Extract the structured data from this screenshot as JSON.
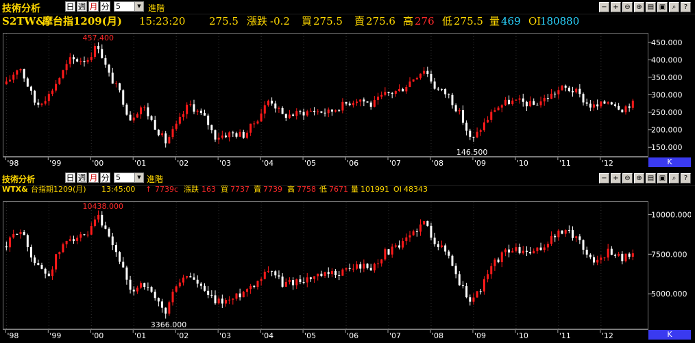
{
  "app": {
    "title": "技術分析",
    "periods": [
      "日",
      "週",
      "月",
      "分"
    ],
    "active_period": "月",
    "interval_value": "5",
    "advanced_label": "進階"
  },
  "panel1": {
    "symbol": "S2TW&",
    "name": "摩台指1209(月)",
    "time": "15:23:20",
    "price": "275.5",
    "change_label": "漲跌",
    "change": "-0.2",
    "bid_label": "買",
    "bid": "275.5",
    "ask_label": "賣",
    "ask": "275.6",
    "high_label": "高",
    "high": "276",
    "low_label": "低",
    "low": "275.5",
    "volume_label": "量",
    "volume": "469",
    "oi_label": "OI",
    "oi": "180880",
    "chart_data": {
      "type": "candlestick",
      "x_labels": [
        "'98",
        "'99",
        "'00",
        "'01",
        "'02",
        "'03",
        "'04",
        "'05",
        "'06",
        "'07",
        "'08",
        "'09",
        "'10",
        "'11",
        "'12"
      ],
      "y_ticks": [
        "450.000",
        "400.000",
        "350.000",
        "300.000",
        "250.000",
        "200.000",
        "150.000"
      ],
      "ylim": [
        125,
        475
      ],
      "annotations": [
        {
          "text": "457.400",
          "value": 457.4,
          "color": "#ff2a2a",
          "year": 2000.15
        },
        {
          "text": "146.500",
          "value": 146.5,
          "color": "#ffffff",
          "year": 2008.95
        }
      ],
      "series": [
        {
          "year": 1998.0,
          "value": 330
        },
        {
          "year": 1998.3,
          "value": 385
        },
        {
          "year": 1998.7,
          "value": 270
        },
        {
          "year": 1999.0,
          "value": 300
        },
        {
          "year": 1999.2,
          "value": 340
        },
        {
          "year": 1999.5,
          "value": 400
        },
        {
          "year": 1999.9,
          "value": 400
        },
        {
          "year": 2000.15,
          "value": 445
        },
        {
          "year": 2000.4,
          "value": 360
        },
        {
          "year": 2000.7,
          "value": 300
        },
        {
          "year": 2000.9,
          "value": 230
        },
        {
          "year": 2001.2,
          "value": 270
        },
        {
          "year": 2001.5,
          "value": 210
        },
        {
          "year": 2001.75,
          "value": 165
        },
        {
          "year": 2002.0,
          "value": 210
        },
        {
          "year": 2002.3,
          "value": 275
        },
        {
          "year": 2002.7,
          "value": 230
        },
        {
          "year": 2002.9,
          "value": 180
        },
        {
          "year": 2003.3,
          "value": 190
        },
        {
          "year": 2003.6,
          "value": 185
        },
        {
          "year": 2003.9,
          "value": 230
        },
        {
          "year": 2004.2,
          "value": 290
        },
        {
          "year": 2004.5,
          "value": 240
        },
        {
          "year": 2004.8,
          "value": 245
        },
        {
          "year": 2005.2,
          "value": 255
        },
        {
          "year": 2005.6,
          "value": 250
        },
        {
          "year": 2005.9,
          "value": 270
        },
        {
          "year": 2006.3,
          "value": 290
        },
        {
          "year": 2006.6,
          "value": 270
        },
        {
          "year": 2006.9,
          "value": 300
        },
        {
          "year": 2007.3,
          "value": 315
        },
        {
          "year": 2007.6,
          "value": 350
        },
        {
          "year": 2007.85,
          "value": 375
        },
        {
          "year": 2008.1,
          "value": 320
        },
        {
          "year": 2008.4,
          "value": 300
        },
        {
          "year": 2008.7,
          "value": 240
        },
        {
          "year": 2008.95,
          "value": 165
        },
        {
          "year": 2009.2,
          "value": 210
        },
        {
          "year": 2009.5,
          "value": 260
        },
        {
          "year": 2009.8,
          "value": 280
        },
        {
          "year": 2010.1,
          "value": 280
        },
        {
          "year": 2010.4,
          "value": 270
        },
        {
          "year": 2010.7,
          "value": 290
        },
        {
          "year": 2010.9,
          "value": 305
        },
        {
          "year": 2011.1,
          "value": 320
        },
        {
          "year": 2011.4,
          "value": 310
        },
        {
          "year": 2011.7,
          "value": 270
        },
        {
          "year": 2011.9,
          "value": 265
        },
        {
          "year": 2012.2,
          "value": 285
        },
        {
          "year": 2012.5,
          "value": 260
        },
        {
          "year": 2012.7,
          "value": 275
        }
      ]
    }
  },
  "panel2": {
    "symbol": "WTX&",
    "name": "台指期1209(月)",
    "time": "13:45:00",
    "arrow": "↑",
    "price": "7739c",
    "change_label": "漲跌",
    "change": "163",
    "bid_label": "買",
    "bid": "7737",
    "ask_label": "賣",
    "ask": "7739",
    "high_label": "高",
    "high": "7758",
    "low_label": "低",
    "low": "7671",
    "volume_label": "量",
    "volume": "101991",
    "oi_label": "OI",
    "oi": "48343",
    "chart_data": {
      "type": "candlestick",
      "x_labels": [
        "'98",
        "'99",
        "'00",
        "'01",
        "'02",
        "'03",
        "'04",
        "'05",
        "'06",
        "'07",
        "'08",
        "'09",
        "'10",
        "'11",
        "'12"
      ],
      "y_ticks": [
        "10000.000",
        "7500.000",
        "5000.000"
      ],
      "ylim": [
        2800,
        10800
      ],
      "annotations": [
        {
          "text": "10438.000",
          "value": 10438,
          "color": "#ff2a2a",
          "year": 2000.15
        },
        {
          "text": "3366.000",
          "value": 3366,
          "color": "#ffffff",
          "year": 2001.75
        }
      ],
      "series": [
        {
          "year": 1998.0,
          "value": 8000
        },
        {
          "year": 1998.3,
          "value": 9200
        },
        {
          "year": 1998.7,
          "value": 6800
        },
        {
          "year": 1999.0,
          "value": 6200
        },
        {
          "year": 1999.2,
          "value": 7500
        },
        {
          "year": 1999.5,
          "value": 8600
        },
        {
          "year": 1999.9,
          "value": 8500
        },
        {
          "year": 2000.15,
          "value": 9900
        },
        {
          "year": 2000.4,
          "value": 8500
        },
        {
          "year": 2000.7,
          "value": 7000
        },
        {
          "year": 2000.9,
          "value": 5000
        },
        {
          "year": 2001.2,
          "value": 5800
        },
        {
          "year": 2001.5,
          "value": 4600
        },
        {
          "year": 2001.75,
          "value": 3800
        },
        {
          "year": 2002.0,
          "value": 5600
        },
        {
          "year": 2002.3,
          "value": 6200
        },
        {
          "year": 2002.7,
          "value": 5000
        },
        {
          "year": 2002.9,
          "value": 4500
        },
        {
          "year": 2003.3,
          "value": 4600
        },
        {
          "year": 2003.6,
          "value": 5200
        },
        {
          "year": 2003.9,
          "value": 5800
        },
        {
          "year": 2004.2,
          "value": 6700
        },
        {
          "year": 2004.5,
          "value": 5600
        },
        {
          "year": 2004.8,
          "value": 5800
        },
        {
          "year": 2005.2,
          "value": 6000
        },
        {
          "year": 2005.6,
          "value": 6200
        },
        {
          "year": 2005.9,
          "value": 6400
        },
        {
          "year": 2006.3,
          "value": 6800
        },
        {
          "year": 2006.6,
          "value": 6600
        },
        {
          "year": 2006.9,
          "value": 7600
        },
        {
          "year": 2007.3,
          "value": 8000
        },
        {
          "year": 2007.6,
          "value": 9000
        },
        {
          "year": 2007.85,
          "value": 9500
        },
        {
          "year": 2008.1,
          "value": 8300
        },
        {
          "year": 2008.4,
          "value": 7500
        },
        {
          "year": 2008.7,
          "value": 5500
        },
        {
          "year": 2008.95,
          "value": 4500
        },
        {
          "year": 2009.2,
          "value": 5500
        },
        {
          "year": 2009.5,
          "value": 7000
        },
        {
          "year": 2009.8,
          "value": 7800
        },
        {
          "year": 2010.1,
          "value": 7700
        },
        {
          "year": 2010.4,
          "value": 7500
        },
        {
          "year": 2010.7,
          "value": 8100
        },
        {
          "year": 2010.9,
          "value": 8700
        },
        {
          "year": 2011.1,
          "value": 8900
        },
        {
          "year": 2011.4,
          "value": 8700
        },
        {
          "year": 2011.7,
          "value": 7400
        },
        {
          "year": 2011.9,
          "value": 7000
        },
        {
          "year": 2012.2,
          "value": 7800
        },
        {
          "year": 2012.5,
          "value": 7200
        },
        {
          "year": 2012.7,
          "value": 7600
        }
      ]
    }
  },
  "toolbar_icons": [
    "minus-icon",
    "plus-icon",
    "zoom-out-icon",
    "zoom-in-icon",
    "settings-icon",
    "save-icon",
    "search-icon",
    "help-icon"
  ]
}
